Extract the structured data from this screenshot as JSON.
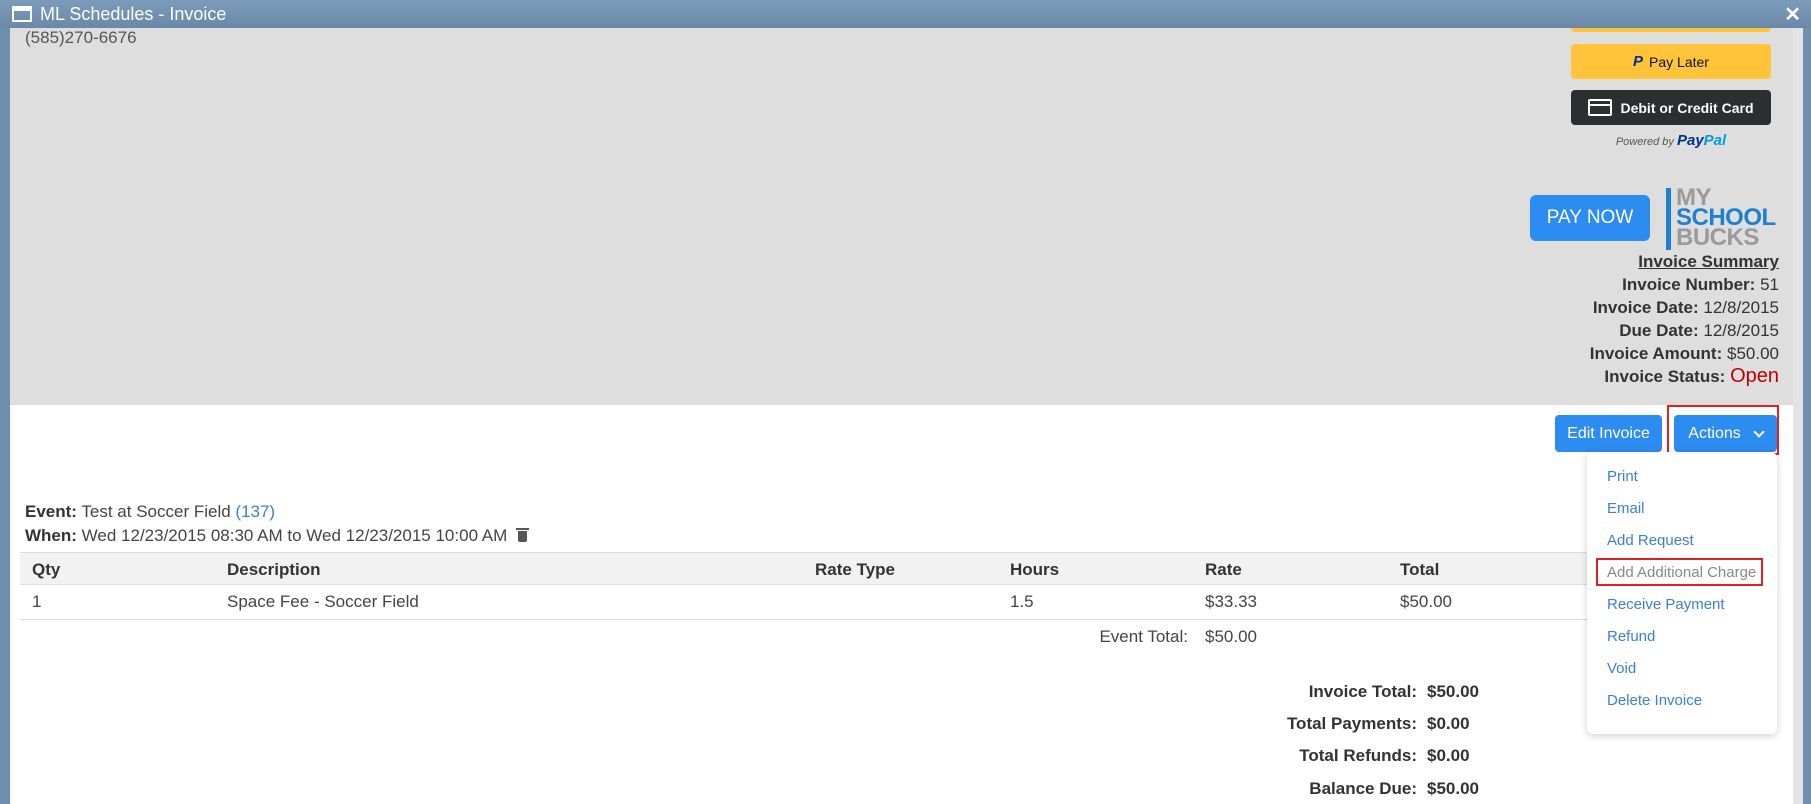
{
  "window": {
    "title": "ML Schedules - Invoice",
    "close_glyph": "✕"
  },
  "header": {
    "phone": "(585)270-6676"
  },
  "paypal": {
    "pay_later_mark": "P",
    "pay_later_label": "Pay Later",
    "card_label": "Debit or Credit Card",
    "powered_by": "Powered by",
    "brand_pay": "Pay",
    "brand_pal": "Pal"
  },
  "pay_now": {
    "label": "PAY NOW"
  },
  "logo": {
    "line1": "MY",
    "line2": "SCHOOL",
    "line3": "BUCKS"
  },
  "summary": {
    "heading": "Invoice Summary",
    "number_label": "Invoice Number:",
    "number_value": "51",
    "date_label": "Invoice Date:",
    "date_value": "12/8/2015",
    "due_label": "Due Date:",
    "due_value": "12/8/2015",
    "amount_label": "Invoice Amount:",
    "amount_value": "$50.00",
    "status_label": "Invoice Status:",
    "status_value": "Open"
  },
  "buttons": {
    "edit": "Edit Invoice",
    "actions": "Actions"
  },
  "actions_menu": [
    "Print",
    "Email",
    "Add Request",
    "Add Additional Charge",
    "Receive Payment",
    "Refund",
    "Void",
    "Delete Invoice"
  ],
  "event": {
    "event_label": "Event:",
    "event_name": "Test at Soccer Field",
    "event_id": "(137)",
    "when_label": "When:",
    "when_value": "Wed 12/23/2015 08:30 AM to Wed 12/23/2015 10:00 AM"
  },
  "table": {
    "headers": [
      "Qty",
      "Description",
      "Rate Type",
      "Hours",
      "Rate",
      "Total"
    ],
    "rows": [
      {
        "qty": "1",
        "description": "Space Fee - Soccer Field",
        "rate_type": "",
        "hours": "1.5",
        "rate": "$33.33",
        "total": "$50.00"
      }
    ],
    "event_total_label": "Event Total:",
    "event_total_value": "$50.00"
  },
  "totals": {
    "invoice_total_label": "Invoice Total:",
    "invoice_total_value": "$50.00",
    "payments_label": "Total Payments:",
    "payments_value": "$0.00",
    "refunds_label": "Total Refunds:",
    "refunds_value": "$0.00",
    "balance_label": "Balance Due:",
    "balance_value": "$50.00"
  },
  "colors": {
    "accent": "#2d8cf0",
    "status_open": "#c00000",
    "highlight": "#e02020",
    "link": "#3b7fd4"
  }
}
